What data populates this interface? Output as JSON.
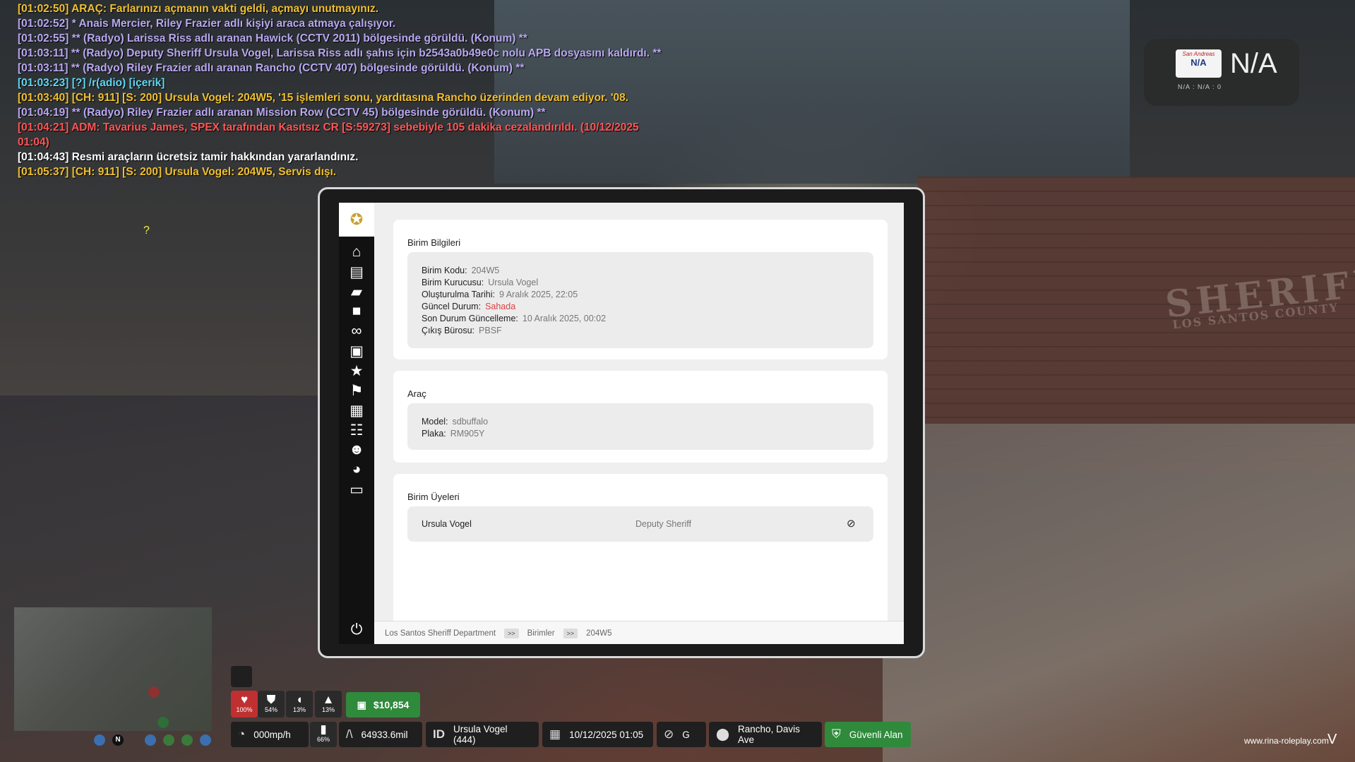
{
  "chat": [
    {
      "time": "[01:02:50]",
      "text": "ARAÇ: Farlarınızı açmanın vakti geldi, açmayı unutmayınız.",
      "color": "yellow"
    },
    {
      "time": "[01:02:52]",
      "text": "* Anais Mercier, Riley Frazier adlı kişiyi araca atmaya çalışıyor.",
      "color": "purple"
    },
    {
      "time": "[01:02:55]",
      "text": "** (Radyo) Larissa Riss adlı aranan Hawick (CCTV 2011) bölgesinde görüldü. (Konum) **",
      "color": "purple"
    },
    {
      "time": "[01:03:11]",
      "text": "** (Radyo) Deputy Sheriff Ursula Vogel, Larissa Riss adlı şahıs için b2543a0b49e0c nolu APB dosyasını kaldırdı. **",
      "color": "purple"
    },
    {
      "time": "[01:03:11]",
      "text": "** (Radyo) Riley Frazier adlı aranan Rancho (CCTV 407) bölgesinde görüldü. (Konum) **",
      "color": "purple"
    },
    {
      "time": "[01:03:23]",
      "text": "[?] /r(adio) [içerik]",
      "color": "cyan"
    },
    {
      "time": "[01:03:40]",
      "text": "[CH: 911] [S: 200] Ursula Vogel: 204W5, '15 işlemleri sonu, yardıtasına Rancho üzerinden devam ediyor. '08.",
      "color": "yellow"
    },
    {
      "time": "[01:04:19]",
      "text": "** (Radyo) Riley Frazier adlı aranan Mission Row (CCTV 45) bölgesinde görüldü. (Konum) **",
      "color": "purple"
    },
    {
      "time": "[01:04:21]",
      "text": "ADM: Tavarius James, SPEX tarafından Kasıtsız CR [S:59273] sebebiyle 105 dakika cezalandırıldı. (10/12/2025",
      "color": "red"
    },
    {
      "time": "",
      "text": "01:04)",
      "color": "red"
    },
    {
      "time": "[01:04:43]",
      "text": "Resmi araçların ücretsiz tamir hakkından yararlandınız.",
      "color": "white"
    },
    {
      "time": "[01:05:37]",
      "text": "[CH: 911] [S: 200] Ursula Vogel: 204W5, Servis dışı.",
      "color": "yellow"
    }
  ],
  "tablet": {
    "unit_info": {
      "title": "Birim Bilgileri",
      "fields": [
        {
          "label": "Birim Kodu:",
          "value": "204W5"
        },
        {
          "label": "Birim Kurucusu:",
          "value": "Ursula Vogel"
        },
        {
          "label": "Oluşturulma Tarihi:",
          "value": "9 Aralık 2025, 22:05"
        },
        {
          "label": "Güncel Durum:",
          "value": "Sahada"
        },
        {
          "label": "Son Durum Güncelleme:",
          "value": "10 Aralık 2025, 00:02"
        },
        {
          "label": "Çıkış Bürosu:",
          "value": "PBSF"
        }
      ]
    },
    "vehicle": {
      "title": "Araç",
      "model_label": "Model:",
      "model_value": "sdbuffalo",
      "plate_label": "Plaka:",
      "plate_value": "RM905Y"
    },
    "members": {
      "title": "Birim Üyeleri",
      "rows": [
        {
          "name": "Ursula Vogel",
          "rank": "Deputy Sheriff"
        }
      ]
    },
    "breadcrumb": [
      "Los Santos Sheriff Department",
      "Birimler",
      "204W5"
    ],
    "breadcrumb_sep": ">>",
    "sidebar_icons": [
      "home-icon",
      "notes-icon",
      "folder-icon",
      "lock-icon",
      "binoculars-icon",
      "briefcase-icon",
      "star-icon",
      "flag-icon",
      "clipboard-icon",
      "users-icon",
      "user-icon",
      "gauge-icon",
      "archive-icon"
    ]
  },
  "plate_widget": {
    "state": "San Andreas",
    "plate": "N/A",
    "big": "N/A",
    "sub": "N/A : N/A : 0"
  },
  "hud": {
    "health": "100%",
    "armor": "54%",
    "hunger": "13%",
    "thirst": "13%",
    "money": "$10,854",
    "speed": "000mp/h",
    "fuel": "66%",
    "distance": "64933.6mil",
    "id_label": "ID",
    "player": "Ursula Vogel (444)",
    "datetime": "10/12/2025 01:05",
    "heading": "G",
    "location": "Rancho, Davis Ave",
    "zone": "Güvenli Alan",
    "minimap_n": "N"
  },
  "site": "www.rina-roleplay.com",
  "sheriff_wall": "SHERIFF",
  "sheriff_wall_sub": "LOS SANTOS COUNTY",
  "qmark": "?"
}
